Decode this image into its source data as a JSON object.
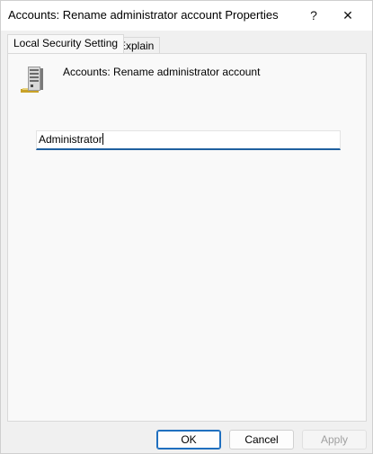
{
  "window": {
    "title": "Accounts: Rename administrator account Properties",
    "help_glyph": "?",
    "close_glyph": "✕"
  },
  "tabs": [
    {
      "label": "Local Security Setting",
      "active": true
    },
    {
      "label": "Explain",
      "active": false
    }
  ],
  "panel": {
    "icon": "server-policy-icon",
    "policy_name": "Accounts: Rename administrator account",
    "input_value": "Administrator"
  },
  "buttons": {
    "ok": "OK",
    "cancel": "Cancel",
    "apply": "Apply",
    "apply_enabled": false
  },
  "colors": {
    "accent": "#1f6fbf",
    "background": "#f0f0f0"
  }
}
